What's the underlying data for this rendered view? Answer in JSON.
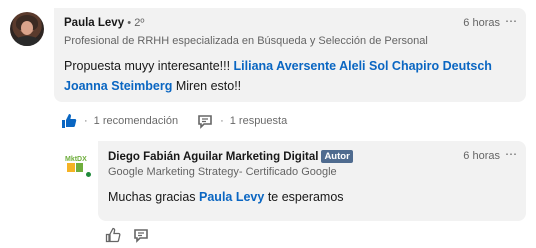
{
  "comment": {
    "author": "Paula Levy",
    "degree": "• 2º",
    "time": "6 horas",
    "headline": "Profesional de RRHH especializada en Búsqueda y Selección de Personal",
    "text_before": "Propuesta muyy interesante!!! ",
    "mention_1": "Liliana Aversente Aleli Sol Chapiro",
    "mention_2": "Deutsch Joanna Steimberg",
    "text_after": " Miren  esto!!",
    "likes_text": "1 recomendación",
    "replies_text": "1 respuesta",
    "separator": "·"
  },
  "reply": {
    "author": "Diego Fabián Aguilar Marketing Digital",
    "badge": "Autor",
    "time": "6 horas",
    "headline": "Google Marketing Strategy- Certificado Google",
    "text_before": "Muchas gracias ",
    "mention": "Paula Levy",
    "text_after": " te esperamos",
    "logo_text": "MktDX"
  },
  "colors": {
    "accent": "#0a66c2",
    "bubble": "#f2f2f2",
    "badge": "#4f6b8f",
    "online": "#1f8a3b"
  },
  "icons": [
    "like-icon",
    "comment-icon",
    "more-options-icon"
  ]
}
